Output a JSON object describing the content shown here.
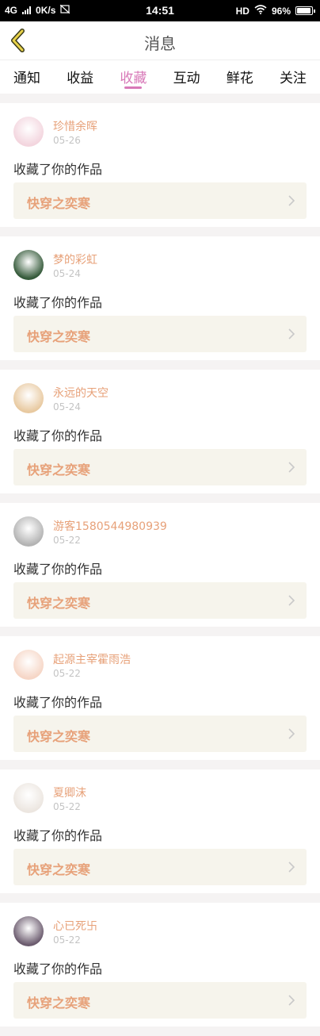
{
  "status_bar": {
    "network": "4G",
    "speed": "0K/s",
    "time": "14:51",
    "hd": "HD",
    "battery": "96%",
    "battery_level": 0.96
  },
  "header": {
    "title": "消息"
  },
  "tabs": [
    {
      "label": "通知",
      "active": false
    },
    {
      "label": "收益",
      "active": false
    },
    {
      "label": "收藏",
      "active": true
    },
    {
      "label": "互动",
      "active": false
    },
    {
      "label": "鲜花",
      "active": false
    },
    {
      "label": "关注",
      "active": false
    }
  ],
  "items": [
    {
      "user": "珍惜余晖",
      "date": "05-26",
      "action": "收藏了你的作品",
      "work": "快穿之奕寒",
      "avatar_color": "#f3d5de"
    },
    {
      "user": "梦的彩虹",
      "date": "05-24",
      "action": "收藏了你的作品",
      "work": "快穿之奕寒",
      "avatar_color": "#355a3a"
    },
    {
      "user": "永远的天空",
      "date": "05-24",
      "action": "收藏了你的作品",
      "work": "快穿之奕寒",
      "avatar_color": "#e8c9a0"
    },
    {
      "user": "游客1580544980939",
      "date": "05-22",
      "action": "收藏了你的作品",
      "work": "快穿之奕寒",
      "avatar_color": "#b3b3b3"
    },
    {
      "user": "起源主宰霍雨浩",
      "date": "05-22",
      "action": "收藏了你的作品",
      "work": "快穿之奕寒",
      "avatar_color": "#f6d6c6"
    },
    {
      "user": "夏卿沫",
      "date": "05-22",
      "action": "收藏了你的作品",
      "work": "快穿之奕寒",
      "avatar_color": "#ece6e0"
    },
    {
      "user": "心已死卐",
      "date": "05-22",
      "action": "收藏了你的作品",
      "work": "快穿之奕寒",
      "avatar_color": "#6b5b6e"
    }
  ]
}
